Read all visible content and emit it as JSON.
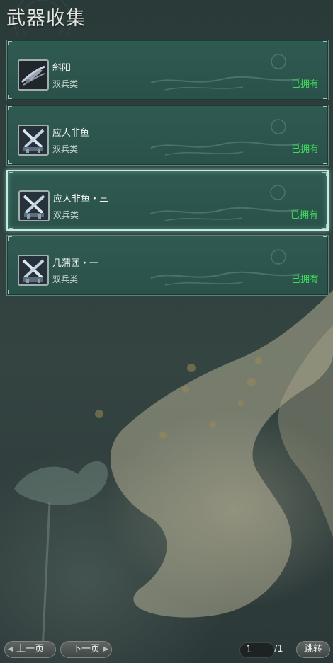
{
  "title": "武器收集",
  "items": [
    {
      "name": "斜阳",
      "type": "双兵类",
      "status": "已拥有",
      "icon": "bow-weapon-icon"
    },
    {
      "name": "应人非鱼",
      "type": "双兵类",
      "status": "已拥有",
      "icon": "crossed-blades-icon"
    },
    {
      "name": "应人非鱼・三",
      "type": "双兵类",
      "status": "已拥有",
      "icon": "crossed-blades-icon"
    },
    {
      "name": "几蒲团・一",
      "type": "双兵类",
      "status": "已拥有",
      "icon": "crossed-blades-icon"
    }
  ],
  "selected_index": 2,
  "pagination": {
    "prev_label": "上一页",
    "next_label": "下一页",
    "current_page": "1",
    "total_pages": "/1",
    "jump_label": "跳转"
  },
  "colors": {
    "status_owned": "#3fdb5a",
    "card_bg": "#2f5a52",
    "selected_border": "#bfeee0"
  }
}
